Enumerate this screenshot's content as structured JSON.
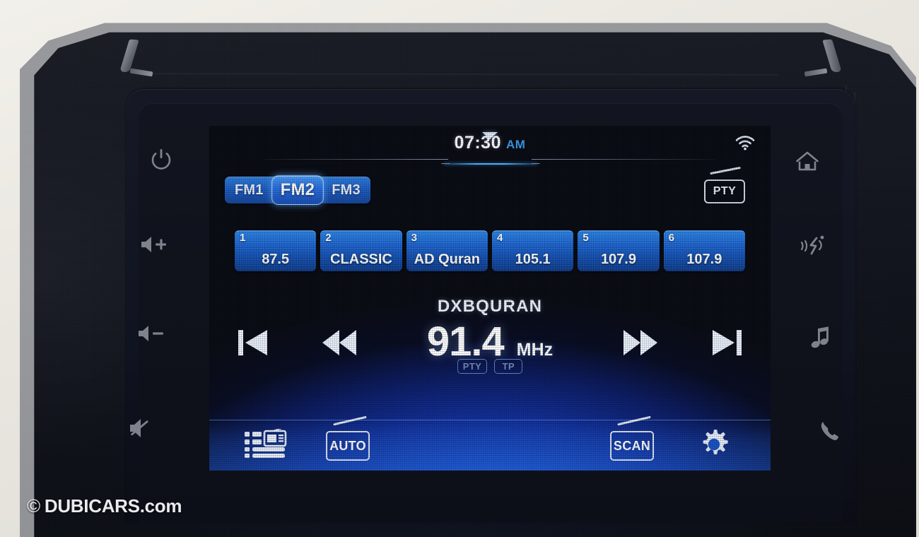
{
  "device": {
    "type": "car-infotainment-head-unit",
    "screen_mode": "FM Radio"
  },
  "status_bar": {
    "time": "07:30",
    "meridiem": "AM",
    "wifi_icon": "wifi-icon",
    "pulldown_handle_icon": "chevron-down-icon"
  },
  "band_selector": {
    "options": [
      "FM1",
      "FM2",
      "FM3"
    ],
    "selected": "FM2"
  },
  "pty_button": {
    "label": "PTY",
    "icon": "radio-antenna-icon"
  },
  "presets": [
    {
      "number": "1",
      "value": "87.5"
    },
    {
      "number": "2",
      "value": "CLASSIC"
    },
    {
      "number": "3",
      "value": "AD Quran"
    },
    {
      "number": "4",
      "value": "105.1"
    },
    {
      "number": "5",
      "value": "107.9"
    },
    {
      "number": "6",
      "value": "107.9"
    }
  ],
  "now_playing": {
    "station_name": "DXBQURAN",
    "frequency": "91.4",
    "unit": "MHz"
  },
  "transport": {
    "prev_icon": "previous-track-icon",
    "rewind_icon": "rewind-icon",
    "forward_icon": "fast-forward-icon",
    "next_icon": "next-track-icon"
  },
  "rds_badges": [
    {
      "label": "PTY",
      "active": false
    },
    {
      "label": "TP",
      "active": false
    }
  ],
  "toolbar": {
    "list_icon": "preset-list-icon",
    "auto_label": "AUTO",
    "scan_label": "SCAN",
    "settings_icon": "gear-icon"
  },
  "bezel_buttons": {
    "left": [
      {
        "name": "power-icon"
      },
      {
        "name": "volume-up-icon"
      },
      {
        "name": "volume-down-icon"
      },
      {
        "name": "mute-icon"
      }
    ],
    "right": [
      {
        "name": "home-icon"
      },
      {
        "name": "voice-command-icon"
      },
      {
        "name": "music-note-icon"
      },
      {
        "name": "phone-icon"
      }
    ]
  },
  "watermark": {
    "copyright": "©",
    "text": "DUBICARS",
    "suffix": ".com"
  },
  "colors": {
    "accent_blue": "#2a86ea",
    "highlight_blue": "#4a9bf5",
    "screen_glow": "#1a49c4",
    "text_white": "#ffffff",
    "ampm_blue": "#3d9ff0"
  }
}
